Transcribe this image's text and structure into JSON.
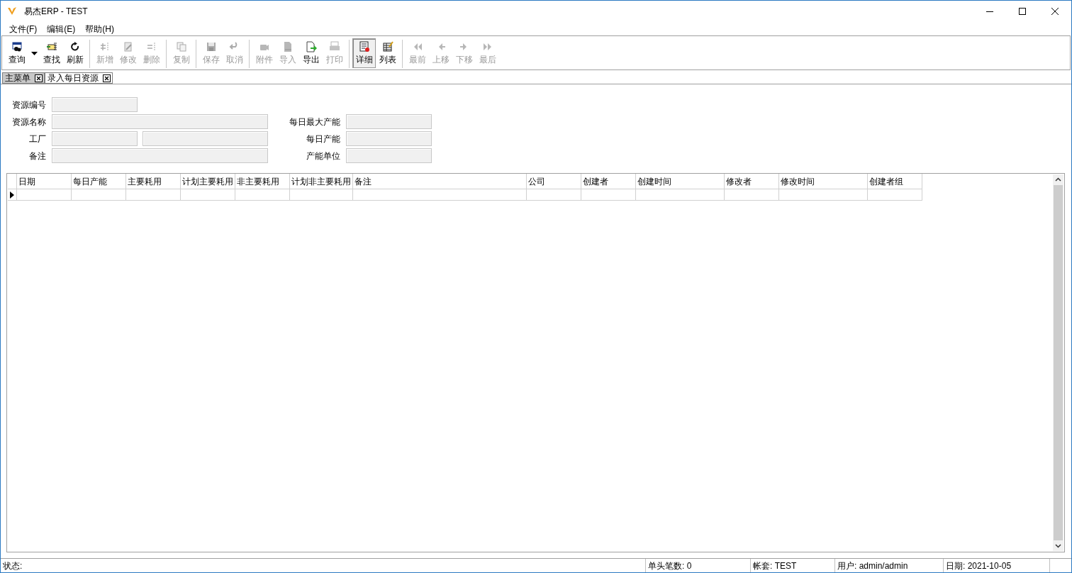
{
  "window": {
    "title": "易杰ERP - TEST"
  },
  "menu": [
    {
      "label": "文件(F)"
    },
    {
      "label": "编辑(E)"
    },
    {
      "label": "帮助(H)"
    }
  ],
  "toolbar": [
    [
      {
        "label": "查询",
        "disabled": false,
        "selected": false,
        "dropdown": true
      },
      {
        "label": "查找",
        "disabled": false,
        "selected": false
      },
      {
        "label": "刷新",
        "disabled": false,
        "selected": false
      }
    ],
    [
      {
        "label": "新增",
        "disabled": true,
        "selected": false
      },
      {
        "label": "修改",
        "disabled": true,
        "selected": false
      },
      {
        "label": "删除",
        "disabled": true,
        "selected": false
      }
    ],
    [
      {
        "label": "复制",
        "disabled": true,
        "selected": false
      }
    ],
    [
      {
        "label": "保存",
        "disabled": true,
        "selected": false
      },
      {
        "label": "取消",
        "disabled": true,
        "selected": false
      }
    ],
    [
      {
        "label": "附件",
        "disabled": true,
        "selected": false
      },
      {
        "label": "导入",
        "disabled": true,
        "selected": false
      },
      {
        "label": "导出",
        "disabled": false,
        "selected": false
      },
      {
        "label": "打印",
        "disabled": true,
        "selected": false
      }
    ],
    [
      {
        "label": "详细",
        "disabled": false,
        "selected": true
      },
      {
        "label": "列表",
        "disabled": false,
        "selected": false
      }
    ],
    [
      {
        "label": "最前",
        "disabled": true,
        "selected": false
      },
      {
        "label": "上移",
        "disabled": true,
        "selected": false
      },
      {
        "label": "下移",
        "disabled": true,
        "selected": false
      },
      {
        "label": "最后",
        "disabled": true,
        "selected": false
      }
    ]
  ],
  "tabs": [
    {
      "label": "主菜单",
      "selected": false
    },
    {
      "label": "录入每日资源",
      "selected": true
    }
  ],
  "form": {
    "left": [
      {
        "label": "资源编号",
        "kind": "short"
      },
      {
        "label": "资源名称",
        "kind": "long"
      },
      {
        "label": "工厂",
        "kind": "split"
      },
      {
        "label": "备注",
        "kind": "long"
      }
    ],
    "right": [
      {
        "label": "每日最大产能"
      },
      {
        "label": "每日产能"
      },
      {
        "label": "产能单位"
      }
    ]
  },
  "grid": {
    "columns": [
      "日期",
      "每日产能",
      "主要耗用",
      "计划主要耗用",
      "非主要耗用",
      "计划非主要耗用",
      "备注",
      "公司",
      "创建者",
      "创建时间",
      "修改者",
      "修改时间",
      "创建者组"
    ]
  },
  "status_bar": [
    "状态:",
    "单头笔数: 0",
    "帐套: TEST",
    "用户: admin/admin",
    "日期: 2021-10-05"
  ]
}
